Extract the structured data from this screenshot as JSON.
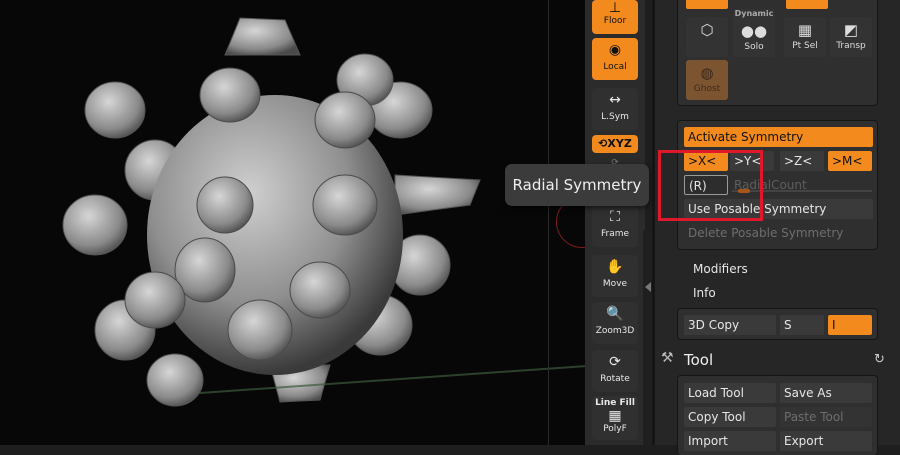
{
  "tooltip": "Radial Symmetry",
  "toolbar": {
    "floor": "Floor",
    "local": "Local",
    "lsym": "L.Sym",
    "xyz": "XYZ",
    "frame": "Frame",
    "move": "Move",
    "zoom3d": "Zoom3D",
    "rotate": "Rotate",
    "linefill_top": "Line Fill",
    "linefill_bottom": "PolyF"
  },
  "subtool_row": {
    "dynamic": "Dynamic",
    "solo": "Solo",
    "ptsel": "Pt Sel",
    "transp": "Transp",
    "ghost": "Ghost"
  },
  "symmetry": {
    "activate": "Activate Symmetry",
    "x": ">X<",
    "y": ">Y<",
    "z": ">Z<",
    "m": ">M<",
    "r": "(R)",
    "radial_count": "RadialCount",
    "use_posable": "Use Posable Symmetry",
    "delete_posable": "Delete Posable Symmetry"
  },
  "modifiers": "Modifiers",
  "info": "Info",
  "copy_row": {
    "copy3d": "3D Copy",
    "s": "S",
    "i": "I"
  },
  "tool": {
    "title": "Tool",
    "load": "Load Tool",
    "save_as": "Save As",
    "copy": "Copy Tool",
    "paste": "Paste Tool",
    "import": "Import",
    "export": "Export"
  },
  "colors": {
    "accent": "#f28a1e",
    "highlight": "#e0182b"
  }
}
